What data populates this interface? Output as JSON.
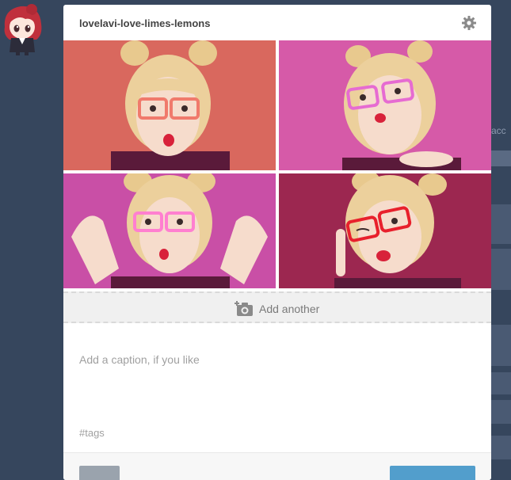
{
  "post": {
    "blog_name": "lovelavi-love-limes-lemons",
    "add_another_label": "Add another",
    "caption_placeholder": "Add a caption, if you like",
    "tags_placeholder": "#tags"
  },
  "photos": [
    {
      "background": "#d9685e",
      "glasses_color": "#f07a6c"
    },
    {
      "background": "#d65aa8",
      "glasses_color": "#e66bd2"
    },
    {
      "background": "#c94fa6",
      "glasses_color": "#ff7fd0"
    },
    {
      "background": "#9c2750",
      "glasses_color": "#e8202c"
    }
  ],
  "colors": {
    "dashboard_bg": "#36465d",
    "primary_button": "#529ecc",
    "secondary_button": "#9aa3ad"
  }
}
